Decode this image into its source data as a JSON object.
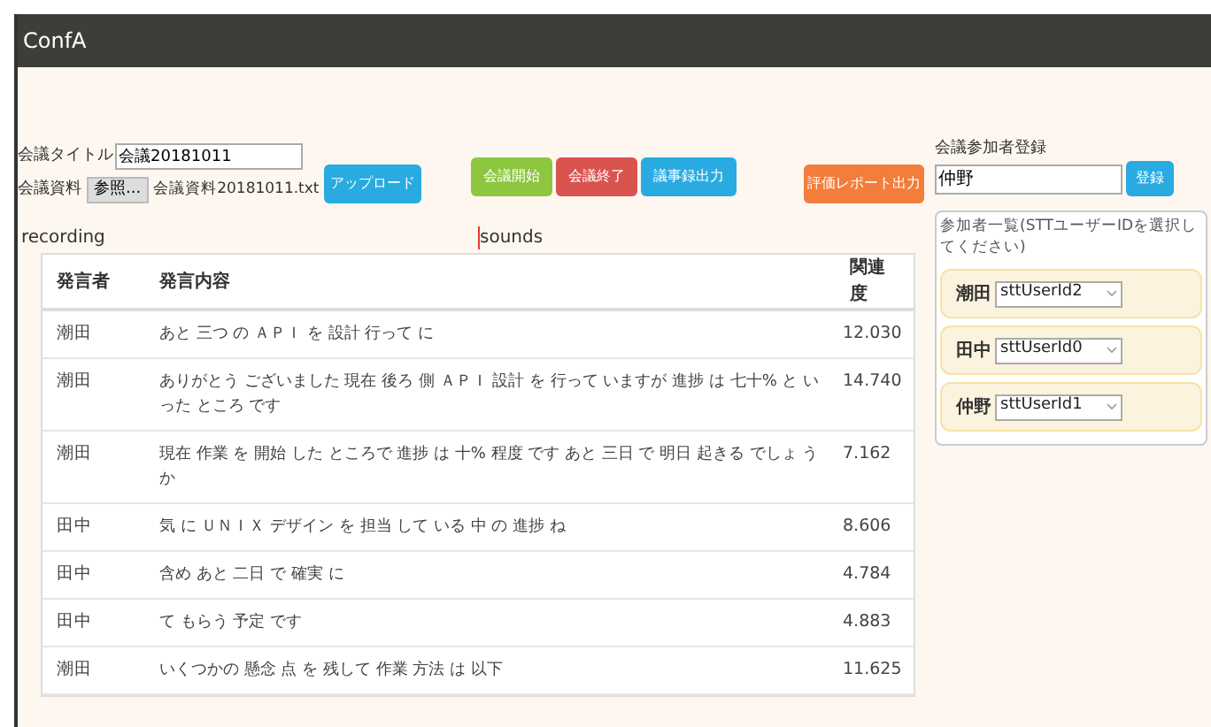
{
  "app_title": "ConfA",
  "meeting_title": {
    "label": "会議タイトル",
    "value": "会議20181011"
  },
  "material": {
    "label": "会議資料",
    "browse_button": "参照...",
    "filename": "会議資料20181011.txt"
  },
  "upload_button": {
    "label": "アップロード",
    "color": "#29abe2"
  },
  "buttons": [
    {
      "label": "会議開始",
      "color": "#8dc63f"
    },
    {
      "label": "会議終了",
      "color": "#d9534f"
    },
    {
      "label": "議事録出力",
      "color": "#29abe2"
    }
  ],
  "report_button": {
    "label": "評価レポート出力",
    "color": "#f37d3b"
  },
  "recording_label": "recording",
  "sounds_label": "sounds",
  "table": {
    "columns": [
      "発言者",
      "発言内容",
      "関連度"
    ],
    "rows": [
      {
        "speaker": "潮田",
        "content": "あと 三つ の ＡＰＩ を 設計 行って に",
        "score": "12.030"
      },
      {
        "speaker": "潮田",
        "content": "ありがとう ございました 現在 後ろ 側 ＡＰＩ 設計 を 行って いますが 進捗 は 七十% と いった ところ です",
        "score": "14.740"
      },
      {
        "speaker": "潮田",
        "content": "現在 作業 を 開始 した ところで 進捗 は 十% 程度 です あと 三日 で 明日 起きる でしょ うか",
        "score": "7.162"
      },
      {
        "speaker": "田中",
        "content": "気 に ＵＮＩＸ デザイン を 担当 して いる 中 の 進捗 ね",
        "score": "8.606"
      },
      {
        "speaker": "田中",
        "content": "含め あと 二日 で 確実 に",
        "score": "4.784"
      },
      {
        "speaker": "田中",
        "content": "て もらう 予定 です",
        "score": "4.883"
      },
      {
        "speaker": "潮田",
        "content": "いくつかの 懸念 点 を 残して 作業 方法 は 以下",
        "score": "11.625"
      }
    ]
  },
  "participant_registration": {
    "label": "会議参加者登録",
    "value": "仲野",
    "button": "登録"
  },
  "participants": {
    "title": "参加者一覧(STTユーザーIDを選択してください)",
    "items": [
      {
        "name": "潮田",
        "user_id": "sttUserId2"
      },
      {
        "name": "田中",
        "user_id": "sttUserId0"
      },
      {
        "name": "仲野",
        "user_id": "sttUserId1"
      }
    ]
  }
}
